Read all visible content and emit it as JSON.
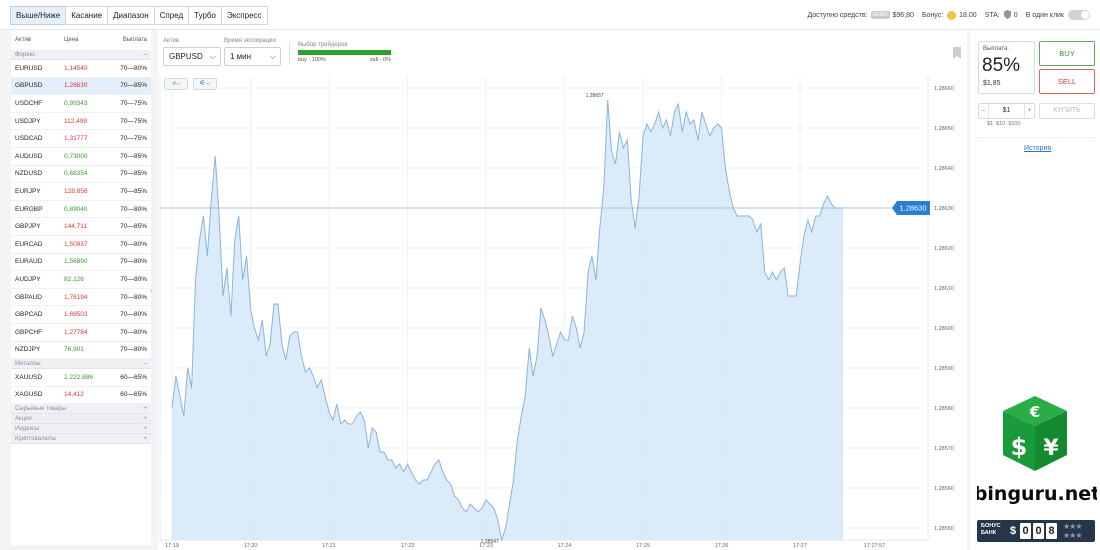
{
  "top_tabs": [
    "Выше/Ниже",
    "Касание",
    "Диапазон",
    "Спред",
    "Турбо",
    "Экспресс"
  ],
  "top_right": {
    "available_label": "Доступно средств:",
    "demo_tag": "DEMO",
    "available_value": "$96,80",
    "bonus_label": "Бонус:",
    "bonus_value": "18,00",
    "status_label": "STA:",
    "status_value": "0",
    "one_click_label": "В один клик"
  },
  "asset_table": {
    "headers": [
      "Актив",
      "Цена",
      "Выплата"
    ],
    "groups": [
      {
        "name": "Форекс",
        "sign": "–",
        "rows": [
          {
            "asset": "EURUSD",
            "price": "1,14540",
            "dir": "down",
            "payout": "70—80%"
          },
          {
            "asset": "GBPUSD",
            "price": "1,28630",
            "dir": "down",
            "payout": "70—85%",
            "selected": true
          },
          {
            "asset": "USDCHF",
            "price": "0,99343",
            "dir": "up",
            "payout": "70—75%"
          },
          {
            "asset": "USDJPY",
            "price": "112,499",
            "dir": "down",
            "payout": "70—75%"
          },
          {
            "asset": "USDCAD",
            "price": "1,31777",
            "dir": "down",
            "payout": "70—75%"
          },
          {
            "asset": "AUDUSD",
            "price": "0,73000",
            "dir": "up",
            "payout": "70—85%"
          },
          {
            "asset": "NZDUSD",
            "price": "0,68354",
            "dir": "up",
            "payout": "70—85%"
          },
          {
            "asset": "EURJPY",
            "price": "128,858",
            "dir": "down",
            "payout": "70—85%"
          },
          {
            "asset": "EURGBP",
            "price": "0,89040",
            "dir": "up",
            "payout": "70—80%"
          },
          {
            "asset": "GBPJPY",
            "price": "144,711",
            "dir": "down",
            "payout": "70—85%"
          },
          {
            "asset": "EURCAD",
            "price": "1,50937",
            "dir": "down",
            "payout": "70—80%"
          },
          {
            "asset": "EURAUD",
            "price": "1,56890",
            "dir": "up",
            "payout": "70—80%"
          },
          {
            "asset": "AUDJPY",
            "price": "82,126",
            "dir": "up",
            "payout": "70—80%"
          },
          {
            "asset": "GBPAUD",
            "price": "1,76194",
            "dir": "down",
            "payout": "70—80%"
          },
          {
            "asset": "GBPCAD",
            "price": "1,69503",
            "dir": "down",
            "payout": "70—80%"
          },
          {
            "asset": "GBPCHF",
            "price": "1,27784",
            "dir": "down",
            "payout": "70—80%"
          },
          {
            "asset": "NZDJPY",
            "price": "76,901",
            "dir": "up",
            "payout": "70—80%"
          }
        ]
      },
      {
        "name": "Металлы",
        "sign": "–",
        "rows": [
          {
            "asset": "XAUUSD",
            "price": "1 222,886",
            "dir": "up",
            "payout": "60—65%"
          },
          {
            "asset": "XAGUSD",
            "price": "14,412",
            "dir": "down",
            "payout": "60—65%"
          }
        ]
      },
      {
        "name": "Сырьевые товары",
        "sign": "+",
        "rows": []
      },
      {
        "name": "Акции",
        "sign": "+",
        "rows": []
      },
      {
        "name": "Индексы",
        "sign": "+",
        "rows": []
      },
      {
        "name": "Криптовалюты",
        "sign": "+",
        "rows": []
      }
    ]
  },
  "chart_controls": {
    "asset_label": "Актив",
    "asset_value": "GBPUSD",
    "expiry_label": "Время экспирации",
    "expiry_value": "1 мин",
    "sentiment_label": "Выбор трейдеров",
    "sentiment_buy": "buy - 100%",
    "sentiment_sell": "sell - 0%",
    "sentiment_buy_fraction": 1.0
  },
  "chart_data": {
    "type": "area",
    "title": "",
    "xlabel": "",
    "ylabel": "",
    "x_ticks": [
      "17:19",
      "17:20",
      "17:21",
      "17:22",
      "17:23",
      "17:24",
      "17:25",
      "17:26",
      "17:27",
      "17:27:57"
    ],
    "y_ticks": [
      "1.28660",
      "1.28650",
      "1.28640",
      "1.28630",
      "1.28620",
      "1.28610",
      "1.28600",
      "1.28590",
      "1.28580",
      "1.28570",
      "1.28560",
      "1.28550"
    ],
    "ylim": [
      1.28547,
      1.28663
    ],
    "current_price": 1.2863,
    "current_price_label": "1.28630",
    "max_annotation": {
      "label": "1.28657",
      "minute": 5.55,
      "value": 1.28657
    },
    "min_annotation": {
      "label": "1.28547",
      "minute": 4.2,
      "value": 1.28547
    },
    "line_color": "#8ab3de",
    "fill_color": "#d6e7f9",
    "series": [
      {
        "minute": 0.0,
        "price": 1.2858
      },
      {
        "minute": 0.05,
        "price": 1.28588
      },
      {
        "minute": 0.1,
        "price": 1.28583
      },
      {
        "minute": 0.15,
        "price": 1.28578
      },
      {
        "minute": 0.2,
        "price": 1.2859
      },
      {
        "minute": 0.25,
        "price": 1.28585
      },
      {
        "minute": 0.3,
        "price": 1.28612
      },
      {
        "minute": 0.35,
        "price": 1.28622
      },
      {
        "minute": 0.4,
        "price": 1.28628
      },
      {
        "minute": 0.45,
        "price": 1.28618
      },
      {
        "minute": 0.5,
        "price": 1.28632
      },
      {
        "minute": 0.55,
        "price": 1.28643
      },
      {
        "minute": 0.6,
        "price": 1.28628
      },
      {
        "minute": 0.65,
        "price": 1.28608
      },
      {
        "minute": 0.7,
        "price": 1.28615
      },
      {
        "minute": 0.75,
        "price": 1.28603
      },
      {
        "minute": 0.8,
        "price": 1.28622
      },
      {
        "minute": 0.85,
        "price": 1.28628
      },
      {
        "minute": 0.9,
        "price": 1.28612
      },
      {
        "minute": 0.95,
        "price": 1.28618
      },
      {
        "minute": 1.0,
        "price": 1.28605
      },
      {
        "minute": 1.05,
        "price": 1.286
      },
      {
        "minute": 1.1,
        "price": 1.28597
      },
      {
        "minute": 1.15,
        "price": 1.28602
      },
      {
        "minute": 1.2,
        "price": 1.28593
      },
      {
        "minute": 1.25,
        "price": 1.28596
      },
      {
        "minute": 1.3,
        "price": 1.28606
      },
      {
        "minute": 1.35,
        "price": 1.28606
      },
      {
        "minute": 1.4,
        "price": 1.28596
      },
      {
        "minute": 1.45,
        "price": 1.28592
      },
      {
        "minute": 1.5,
        "price": 1.28598
      },
      {
        "minute": 1.55,
        "price": 1.28599
      },
      {
        "minute": 1.6,
        "price": 1.28599
      },
      {
        "minute": 1.65,
        "price": 1.28593
      },
      {
        "minute": 1.7,
        "price": 1.28589
      },
      {
        "minute": 1.75,
        "price": 1.2859
      },
      {
        "minute": 1.8,
        "price": 1.28588
      },
      {
        "minute": 1.85,
        "price": 1.28585
      },
      {
        "minute": 1.9,
        "price": 1.28587
      },
      {
        "minute": 1.95,
        "price": 1.28583
      },
      {
        "minute": 2.0,
        "price": 1.28579
      },
      {
        "minute": 2.05,
        "price": 1.28577
      },
      {
        "minute": 2.1,
        "price": 1.28581
      },
      {
        "minute": 2.15,
        "price": 1.28576
      },
      {
        "minute": 2.2,
        "price": 1.28577
      },
      {
        "minute": 2.25,
        "price": 1.28576
      },
      {
        "minute": 2.3,
        "price": 1.28576
      },
      {
        "minute": 2.35,
        "price": 1.28578
      },
      {
        "minute": 2.4,
        "price": 1.28579
      },
      {
        "minute": 2.45,
        "price": 1.28577
      },
      {
        "minute": 2.5,
        "price": 1.2857
      },
      {
        "minute": 2.55,
        "price": 1.28575
      },
      {
        "minute": 2.6,
        "price": 1.28574
      },
      {
        "minute": 2.65,
        "price": 1.28569
      },
      {
        "minute": 2.7,
        "price": 1.28569
      },
      {
        "minute": 2.75,
        "price": 1.28567
      },
      {
        "minute": 2.8,
        "price": 1.28567
      },
      {
        "minute": 2.85,
        "price": 1.28565
      },
      {
        "minute": 2.9,
        "price": 1.28566
      },
      {
        "minute": 2.95,
        "price": 1.28564
      },
      {
        "minute": 3.0,
        "price": 1.28566
      },
      {
        "minute": 3.05,
        "price": 1.28564
      },
      {
        "minute": 3.1,
        "price": 1.28562
      },
      {
        "minute": 3.15,
        "price": 1.28561
      },
      {
        "minute": 3.2,
        "price": 1.28562
      },
      {
        "minute": 3.25,
        "price": 1.28562
      },
      {
        "minute": 3.3,
        "price": 1.28564
      },
      {
        "minute": 3.35,
        "price": 1.28566
      },
      {
        "minute": 3.4,
        "price": 1.28567
      },
      {
        "minute": 3.45,
        "price": 1.28564
      },
      {
        "minute": 3.5,
        "price": 1.28562
      },
      {
        "minute": 3.55,
        "price": 1.28561
      },
      {
        "minute": 3.6,
        "price": 1.28558
      },
      {
        "minute": 3.65,
        "price": 1.28557
      },
      {
        "minute": 3.7,
        "price": 1.28555
      },
      {
        "minute": 3.75,
        "price": 1.28554
      },
      {
        "minute": 3.8,
        "price": 1.28556
      },
      {
        "minute": 3.85,
        "price": 1.28555
      },
      {
        "minute": 3.9,
        "price": 1.28554
      },
      {
        "minute": 3.95,
        "price": 1.28555
      },
      {
        "minute": 4.0,
        "price": 1.28557
      },
      {
        "minute": 4.05,
        "price": 1.28556
      },
      {
        "minute": 4.1,
        "price": 1.28555
      },
      {
        "minute": 4.15,
        "price": 1.28552
      },
      {
        "minute": 4.2,
        "price": 1.28547
      },
      {
        "minute": 4.25,
        "price": 1.2855
      },
      {
        "minute": 4.3,
        "price": 1.28556
      },
      {
        "minute": 4.35,
        "price": 1.28562
      },
      {
        "minute": 4.4,
        "price": 1.28572
      },
      {
        "minute": 4.45,
        "price": 1.28578
      },
      {
        "minute": 4.5,
        "price": 1.28583
      },
      {
        "minute": 4.55,
        "price": 1.28595
      },
      {
        "minute": 4.6,
        "price": 1.28588
      },
      {
        "minute": 4.65,
        "price": 1.28593
      },
      {
        "minute": 4.7,
        "price": 1.28605
      },
      {
        "minute": 4.75,
        "price": 1.28602
      },
      {
        "minute": 4.8,
        "price": 1.28598
      },
      {
        "minute": 4.85,
        "price": 1.28593
      },
      {
        "minute": 4.9,
        "price": 1.28596
      },
      {
        "minute": 4.95,
        "price": 1.28599
      },
      {
        "minute": 5.0,
        "price": 1.28597
      },
      {
        "minute": 5.05,
        "price": 1.28597
      },
      {
        "minute": 5.1,
        "price": 1.28603
      },
      {
        "minute": 5.15,
        "price": 1.286
      },
      {
        "minute": 5.2,
        "price": 1.28595
      },
      {
        "minute": 5.25,
        "price": 1.28599
      },
      {
        "minute": 5.3,
        "price": 1.28614
      },
      {
        "minute": 5.35,
        "price": 1.28618
      },
      {
        "minute": 5.4,
        "price": 1.28612
      },
      {
        "minute": 5.45,
        "price": 1.28625
      },
      {
        "minute": 5.5,
        "price": 1.28635
      },
      {
        "minute": 5.55,
        "price": 1.28657
      },
      {
        "minute": 5.6,
        "price": 1.28644
      },
      {
        "minute": 5.65,
        "price": 1.28641
      },
      {
        "minute": 5.7,
        "price": 1.28649
      },
      {
        "minute": 5.75,
        "price": 1.28645
      },
      {
        "minute": 5.8,
        "price": 1.28647
      },
      {
        "minute": 5.85,
        "price": 1.28632
      },
      {
        "minute": 5.9,
        "price": 1.28625
      },
      {
        "minute": 5.95,
        "price": 1.28633
      },
      {
        "minute": 6.0,
        "price": 1.28648
      },
      {
        "minute": 6.05,
        "price": 1.28651
      },
      {
        "minute": 6.1,
        "price": 1.28649
      },
      {
        "minute": 6.15,
        "price": 1.28651
      },
      {
        "minute": 6.2,
        "price": 1.28654
      },
      {
        "minute": 6.25,
        "price": 1.2865
      },
      {
        "minute": 6.3,
        "price": 1.28652
      },
      {
        "minute": 6.35,
        "price": 1.28648
      },
      {
        "minute": 6.4,
        "price": 1.28654
      },
      {
        "minute": 6.45,
        "price": 1.28656
      },
      {
        "minute": 6.5,
        "price": 1.28649
      },
      {
        "minute": 6.55,
        "price": 1.28654
      },
      {
        "minute": 6.6,
        "price": 1.28651
      },
      {
        "minute": 6.65,
        "price": 1.28652
      },
      {
        "minute": 6.7,
        "price": 1.28647
      },
      {
        "minute": 6.75,
        "price": 1.28654
      },
      {
        "minute": 6.8,
        "price": 1.28651
      },
      {
        "minute": 6.85,
        "price": 1.28648
      },
      {
        "minute": 6.9,
        "price": 1.2865
      },
      {
        "minute": 6.95,
        "price": 1.28651
      },
      {
        "minute": 7.0,
        "price": 1.2865
      },
      {
        "minute": 7.05,
        "price": 1.2864
      },
      {
        "minute": 7.1,
        "price": 1.28634
      },
      {
        "minute": 7.15,
        "price": 1.2863
      },
      {
        "minute": 7.2,
        "price": 1.28628
      },
      {
        "minute": 7.25,
        "price": 1.28628
      },
      {
        "minute": 7.3,
        "price": 1.28628
      },
      {
        "minute": 7.35,
        "price": 1.28628
      },
      {
        "minute": 7.4,
        "price": 1.28627
      },
      {
        "minute": 7.45,
        "price": 1.28624
      },
      {
        "minute": 7.5,
        "price": 1.28626
      },
      {
        "minute": 7.55,
        "price": 1.28614
      },
      {
        "minute": 7.6,
        "price": 1.28612
      },
      {
        "minute": 7.65,
        "price": 1.28614
      },
      {
        "minute": 7.7,
        "price": 1.28612
      },
      {
        "minute": 7.75,
        "price": 1.28614
      },
      {
        "minute": 7.8,
        "price": 1.28615
      },
      {
        "minute": 7.85,
        "price": 1.28608
      },
      {
        "minute": 7.9,
        "price": 1.28608
      },
      {
        "minute": 7.95,
        "price": 1.28608
      },
      {
        "minute": 8.0,
        "price": 1.28616
      },
      {
        "minute": 8.05,
        "price": 1.28623
      },
      {
        "minute": 8.1,
        "price": 1.28627
      },
      {
        "minute": 8.15,
        "price": 1.28624
      },
      {
        "minute": 8.2,
        "price": 1.28628
      },
      {
        "minute": 8.25,
        "price": 1.28628
      },
      {
        "minute": 8.3,
        "price": 1.28631
      },
      {
        "minute": 8.35,
        "price": 1.28633
      },
      {
        "minute": 8.4,
        "price": 1.28631
      },
      {
        "minute": 8.45,
        "price": 1.2863
      },
      {
        "minute": 8.5,
        "price": 1.2863
      },
      {
        "minute": 8.55,
        "price": 1.2863
      }
    ]
  },
  "order_panel": {
    "payout_label": "Выплата:",
    "payout_percent": "85%",
    "payout_amount": "$1,85",
    "buy_label": "BUY",
    "sell_label": "SELL",
    "minus_label": "–",
    "amount_value": "$1",
    "plus_label": "+",
    "quick_amounts": [
      "$1",
      "$10",
      "$100"
    ],
    "purchase_label": "КУПИТЬ",
    "history_label": "История"
  },
  "promo": {
    "site_name": "binguru.net",
    "bonus_line1": "БОНУС",
    "bonus_line2": "БАНК",
    "counter_currency": "$",
    "counter_digits": [
      "0",
      "0",
      "8"
    ]
  },
  "colors": {
    "accent_blue": "#2f74c0",
    "buy_green": "#2f8f2f",
    "sell_red": "#cf3636",
    "price_up": "#3a9a2e",
    "price_down": "#d23b3b",
    "current_price_bg": "#2a7fd4",
    "logo_green": "#1a9a3a"
  }
}
